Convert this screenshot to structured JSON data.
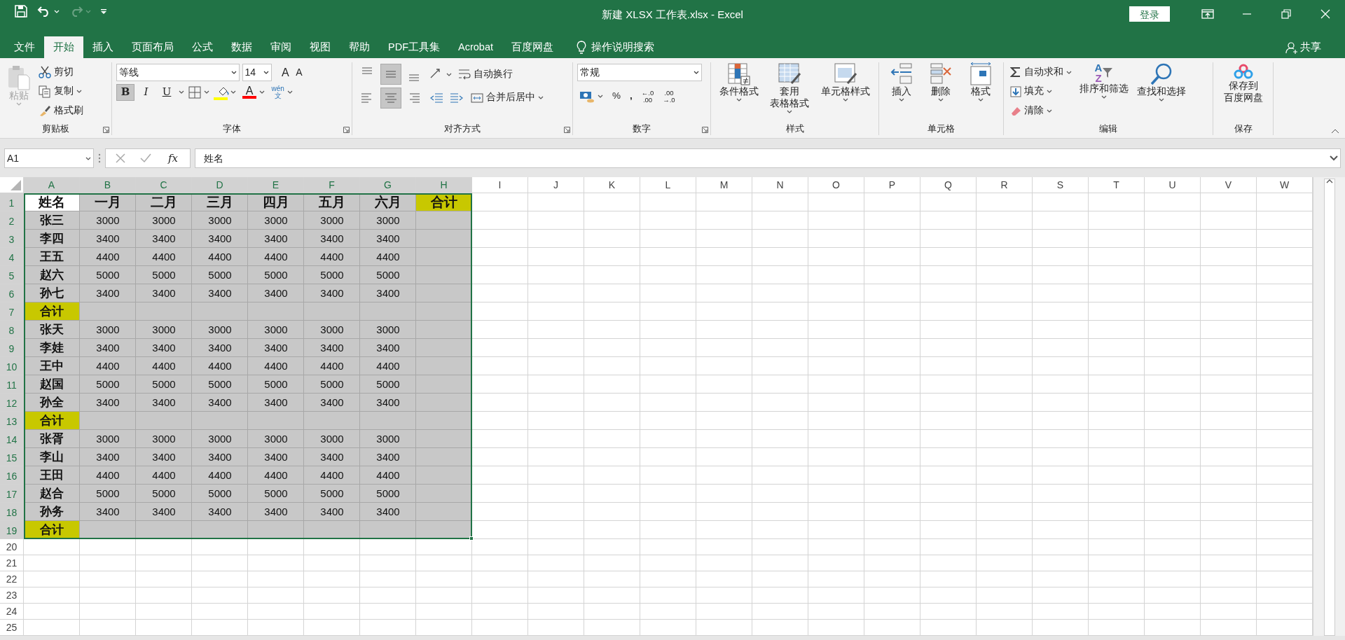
{
  "window": {
    "title": "新建 XLSX 工作表.xlsx  -  Excel",
    "sign_in": "登录"
  },
  "menu_tabs": [
    {
      "label": "文件",
      "selected": false
    },
    {
      "label": "开始",
      "selected": true
    },
    {
      "label": "插入",
      "selected": false
    },
    {
      "label": "页面布局",
      "selected": false
    },
    {
      "label": "公式",
      "selected": false
    },
    {
      "label": "数据",
      "selected": false
    },
    {
      "label": "审阅",
      "selected": false
    },
    {
      "label": "视图",
      "selected": false
    },
    {
      "label": "帮助",
      "selected": false
    },
    {
      "label": "PDF工具集",
      "selected": false
    },
    {
      "label": "Acrobat",
      "selected": false
    },
    {
      "label": "百度网盘",
      "selected": false
    }
  ],
  "tell_me": "操作说明搜索",
  "share": "共享",
  "ribbon": {
    "clipboard": {
      "title": "剪贴板",
      "paste": {
        "label": "粘贴",
        "disabled": true
      },
      "cut": "剪切",
      "copy": "复制",
      "format_painter": "格式刷"
    },
    "font": {
      "title": "字体",
      "font_name": "等线",
      "font_size": "14",
      "grow": "A",
      "shrink": "A",
      "styles": [
        {
          "label": "B",
          "kind": "bold",
          "selected": true
        },
        {
          "label": "I",
          "kind": "italic",
          "selected": false
        },
        {
          "label": "U",
          "kind": "underline",
          "selected": false
        }
      ],
      "font_color_label": "A",
      "phonetic": [
        "wén",
        "文"
      ]
    },
    "alignment": {
      "title": "对齐方式",
      "vertical": [
        {
          "kind": "top",
          "selected": false
        },
        {
          "kind": "middle",
          "selected": true
        },
        {
          "kind": "bottom",
          "selected": false
        }
      ],
      "horizontal": [
        {
          "kind": "left",
          "selected": false
        },
        {
          "kind": "center",
          "selected": true
        },
        {
          "kind": "right",
          "selected": false
        }
      ],
      "wrap_text": "自动换行",
      "merge_center": "合并后居中"
    },
    "number": {
      "title": "数字",
      "format": "常规",
      "percent": "%",
      "comma": ",",
      "increase_decimal": [
        "←.0",
        ".00"
      ],
      "decrease_decimal": [
        ".00",
        "→.0"
      ]
    },
    "styles": {
      "title": "样式",
      "buttons": [
        {
          "kind": "conditional",
          "label_lines": [
            "条件格式"
          ]
        },
        {
          "kind": "table",
          "label_lines": [
            "套用",
            "表格格式"
          ]
        },
        {
          "kind": "cell",
          "label_lines": [
            "单元格样式"
          ]
        }
      ]
    },
    "cells": {
      "title": "单元格",
      "buttons": [
        {
          "kind": "insert",
          "label": "插入"
        },
        {
          "kind": "delete",
          "label": "删除"
        },
        {
          "kind": "format",
          "label": "格式"
        }
      ]
    },
    "editing": {
      "title": "编辑",
      "autosum": "自动求和",
      "fill": "填充",
      "clear": "清除",
      "sort_letters": [
        "A",
        "Z"
      ],
      "sort_filter": "排序和筛选",
      "find_select": "查找和选择"
    },
    "save": {
      "title": "保存",
      "label_lines": [
        "保存到",
        "百度网盘"
      ]
    }
  },
  "formula_bar": {
    "name_box": "A1",
    "fx": "fx",
    "formula": "姓名"
  },
  "sheet": {
    "columns": [
      {
        "label": "A",
        "selected": true
      },
      {
        "label": "B",
        "selected": true
      },
      {
        "label": "C",
        "selected": true
      },
      {
        "label": "D",
        "selected": true
      },
      {
        "label": "E",
        "selected": true
      },
      {
        "label": "F",
        "selected": true
      },
      {
        "label": "G",
        "selected": true
      },
      {
        "label": "H",
        "selected": true
      },
      {
        "label": "I",
        "selected": false
      },
      {
        "label": "J",
        "selected": false
      },
      {
        "label": "K",
        "selected": false
      },
      {
        "label": "L",
        "selected": false
      },
      {
        "label": "M",
        "selected": false
      },
      {
        "label": "N",
        "selected": false
      },
      {
        "label": "O",
        "selected": false
      },
      {
        "label": "P",
        "selected": false
      },
      {
        "label": "Q",
        "selected": false
      },
      {
        "label": "R",
        "selected": false
      },
      {
        "label": "S",
        "selected": false
      },
      {
        "label": "T",
        "selected": false
      },
      {
        "label": "U",
        "selected": false
      },
      {
        "label": "V",
        "selected": false
      },
      {
        "label": "W",
        "selected": false
      }
    ],
    "rows": [
      {
        "number": "1",
        "selected": true,
        "cells": [
          {
            "text": "姓名"
          },
          {
            "text": "一月"
          },
          {
            "text": "二月"
          },
          {
            "text": "三月"
          },
          {
            "text": "四月"
          },
          {
            "text": "五月"
          },
          {
            "text": "六月"
          },
          {
            "text": "合计",
            "color": "#c8c800"
          }
        ]
      },
      {
        "number": "2",
        "selected": true,
        "cells": [
          {
            "text": "张三"
          },
          {
            "text": "3000"
          },
          {
            "text": "3000"
          },
          {
            "text": "3000"
          },
          {
            "text": "3000"
          },
          {
            "text": "3000"
          },
          {
            "text": "3000"
          }
        ]
      },
      {
        "number": "3",
        "selected": true,
        "cells": [
          {
            "text": "李四"
          },
          {
            "text": "3400"
          },
          {
            "text": "3400"
          },
          {
            "text": "3400"
          },
          {
            "text": "3400"
          },
          {
            "text": "3400"
          },
          {
            "text": "3400"
          }
        ]
      },
      {
        "number": "4",
        "selected": true,
        "cells": [
          {
            "text": "王五"
          },
          {
            "text": "4400"
          },
          {
            "text": "4400"
          },
          {
            "text": "4400"
          },
          {
            "text": "4400"
          },
          {
            "text": "4400"
          },
          {
            "text": "4400"
          }
        ]
      },
      {
        "number": "5",
        "selected": true,
        "cells": [
          {
            "text": "赵六"
          },
          {
            "text": "5000"
          },
          {
            "text": "5000"
          },
          {
            "text": "5000"
          },
          {
            "text": "5000"
          },
          {
            "text": "5000"
          },
          {
            "text": "5000"
          }
        ]
      },
      {
        "number": "6",
        "selected": true,
        "cells": [
          {
            "text": "孙七"
          },
          {
            "text": "3400"
          },
          {
            "text": "3400"
          },
          {
            "text": "3400"
          },
          {
            "text": "3400"
          },
          {
            "text": "3400"
          },
          {
            "text": "3400"
          }
        ]
      },
      {
        "number": "7",
        "selected": true,
        "cells": [
          {
            "text": "合计",
            "color": "#c8c800"
          }
        ]
      },
      {
        "number": "8",
        "selected": true,
        "cells": [
          {
            "text": "张天"
          },
          {
            "text": "3000"
          },
          {
            "text": "3000"
          },
          {
            "text": "3000"
          },
          {
            "text": "3000"
          },
          {
            "text": "3000"
          },
          {
            "text": "3000"
          }
        ]
      },
      {
        "number": "9",
        "selected": true,
        "cells": [
          {
            "text": "李娃"
          },
          {
            "text": "3400"
          },
          {
            "text": "3400"
          },
          {
            "text": "3400"
          },
          {
            "text": "3400"
          },
          {
            "text": "3400"
          },
          {
            "text": "3400"
          }
        ]
      },
      {
        "number": "10",
        "selected": true,
        "cells": [
          {
            "text": "王中"
          },
          {
            "text": "4400"
          },
          {
            "text": "4400"
          },
          {
            "text": "4400"
          },
          {
            "text": "4400"
          },
          {
            "text": "4400"
          },
          {
            "text": "4400"
          }
        ]
      },
      {
        "number": "11",
        "selected": true,
        "cells": [
          {
            "text": "赵国"
          },
          {
            "text": "5000"
          },
          {
            "text": "5000"
          },
          {
            "text": "5000"
          },
          {
            "text": "5000"
          },
          {
            "text": "5000"
          },
          {
            "text": "5000"
          }
        ]
      },
      {
        "number": "12",
        "selected": true,
        "cells": [
          {
            "text": "孙全"
          },
          {
            "text": "3400"
          },
          {
            "text": "3400"
          },
          {
            "text": "3400"
          },
          {
            "text": "3400"
          },
          {
            "text": "3400"
          },
          {
            "text": "3400"
          }
        ]
      },
      {
        "number": "13",
        "selected": true,
        "cells": [
          {
            "text": "合计",
            "color": "#c8c800"
          }
        ]
      },
      {
        "number": "14",
        "selected": true,
        "cells": [
          {
            "text": "张胥"
          },
          {
            "text": "3000"
          },
          {
            "text": "3000"
          },
          {
            "text": "3000"
          },
          {
            "text": "3000"
          },
          {
            "text": "3000"
          },
          {
            "text": "3000"
          }
        ]
      },
      {
        "number": "15",
        "selected": true,
        "cells": [
          {
            "text": "李山"
          },
          {
            "text": "3400"
          },
          {
            "text": "3400"
          },
          {
            "text": "3400"
          },
          {
            "text": "3400"
          },
          {
            "text": "3400"
          },
          {
            "text": "3400"
          }
        ]
      },
      {
        "number": "16",
        "selected": true,
        "cells": [
          {
            "text": "王田"
          },
          {
            "text": "4400"
          },
          {
            "text": "4400"
          },
          {
            "text": "4400"
          },
          {
            "text": "4400"
          },
          {
            "text": "4400"
          },
          {
            "text": "4400"
          }
        ]
      },
      {
        "number": "17",
        "selected": true,
        "cells": [
          {
            "text": "赵合"
          },
          {
            "text": "5000"
          },
          {
            "text": "5000"
          },
          {
            "text": "5000"
          },
          {
            "text": "5000"
          },
          {
            "text": "5000"
          },
          {
            "text": "5000"
          }
        ]
      },
      {
        "number": "18",
        "selected": true,
        "cells": [
          {
            "text": "孙务"
          },
          {
            "text": "3400"
          },
          {
            "text": "3400"
          },
          {
            "text": "3400"
          },
          {
            "text": "3400"
          },
          {
            "text": "3400"
          },
          {
            "text": "3400"
          }
        ]
      },
      {
        "number": "19",
        "selected": true,
        "cells": [
          {
            "text": "合计",
            "color": "#c8c800"
          }
        ]
      },
      {
        "number": "20",
        "selected": false
      },
      {
        "number": "21",
        "selected": false
      },
      {
        "number": "22",
        "selected": false
      },
      {
        "number": "23",
        "selected": false
      },
      {
        "number": "24",
        "selected": false
      },
      {
        "number": "25",
        "selected": false
      }
    ]
  }
}
